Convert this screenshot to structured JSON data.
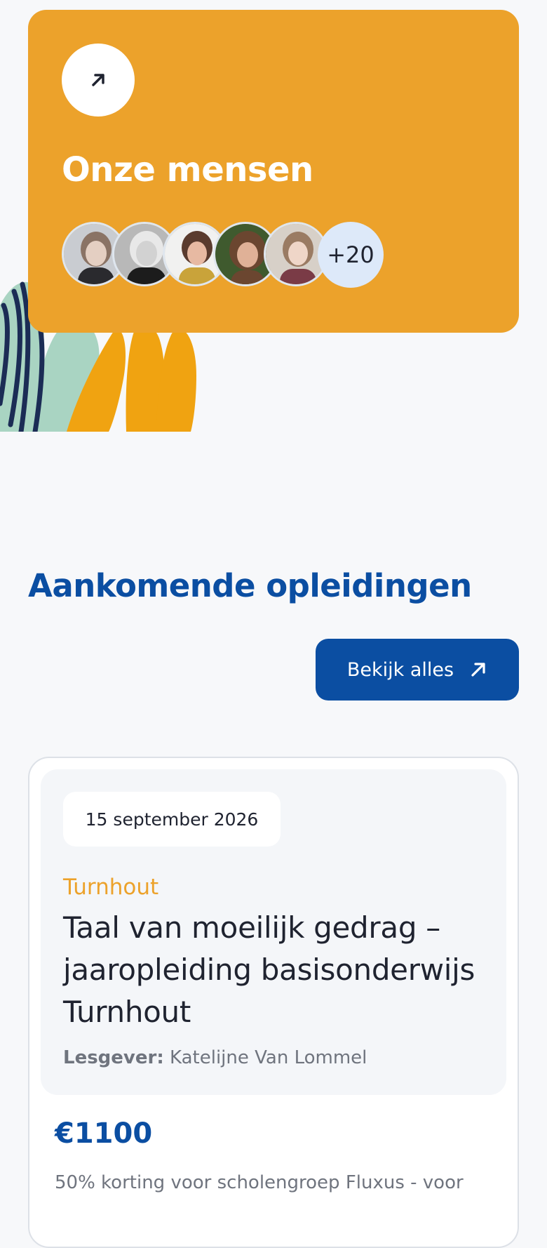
{
  "people_card": {
    "title": "Onze mensen",
    "more_count": "+20",
    "avatars": [
      "avatar-1",
      "avatar-2",
      "avatar-3",
      "avatar-4",
      "avatar-5"
    ],
    "background": "#eca22b"
  },
  "courses_section": {
    "title": "Aankomende opleidingen",
    "view_all_label": "Bekijk alles"
  },
  "course": {
    "date": "15 september 2026",
    "location": "Turnhout",
    "title": "Taal van moeilijk gedrag – jaaropleiding basisonderwijs Turnhout",
    "teacher_label": "Lesgever:",
    "teacher_name": "Katelijne Van Lommel",
    "price": "€1100",
    "discount": "50% korting voor scholengroep Fluxus - voor"
  },
  "colors": {
    "accent_orange": "#eca22b",
    "brand_blue": "#0b4ea2",
    "page_bg": "#f7f8fa"
  }
}
